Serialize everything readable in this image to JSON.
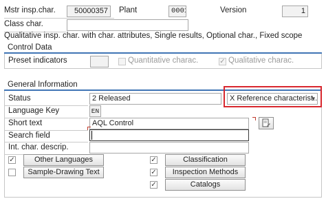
{
  "header": {
    "mstr_label": "Mstr insp.char.",
    "mstr_value": "50000357",
    "plant_label": "Plant",
    "plant_value": "0001",
    "version_label": "Version",
    "version_value": "1",
    "class_label": "Class char.",
    "class_value": "",
    "description": "Qualitative insp. char. with char. attributes, Single results, Optional char., Fixed scope"
  },
  "control_data": {
    "title": "Control Data",
    "preset_label": "Preset indicators",
    "quantitative_label": "Quantitative charac.",
    "qualitative_label": "Qualitative charac.",
    "quantitative_checked": false,
    "qualitative_checked": true
  },
  "general_info": {
    "title": "General Information",
    "status_label": "Status",
    "status_value": "2 Released",
    "reference_value": "X Reference characterist...",
    "language_label": "Language Key",
    "language_value": "EN",
    "short_text_label": "Short text",
    "short_text_value": "AQL Control",
    "search_label": "Search field",
    "search_value": "",
    "int_desc_label": "Int. char. descrip.",
    "int_desc_value": ""
  },
  "buttons": {
    "other_languages": "Other Languages",
    "sample_drawing": "Sample-Drawing Text",
    "classification": "Classification",
    "inspection_methods": "Inspection Methods",
    "catalogs": "Catalogs"
  },
  "checks": {
    "other_languages": true,
    "sample_drawing": false,
    "classification": true,
    "inspection_methods": true,
    "catalogs": true
  },
  "colors": {
    "accent_blue": "#3f74b5",
    "highlight_red": "#d8262d"
  }
}
